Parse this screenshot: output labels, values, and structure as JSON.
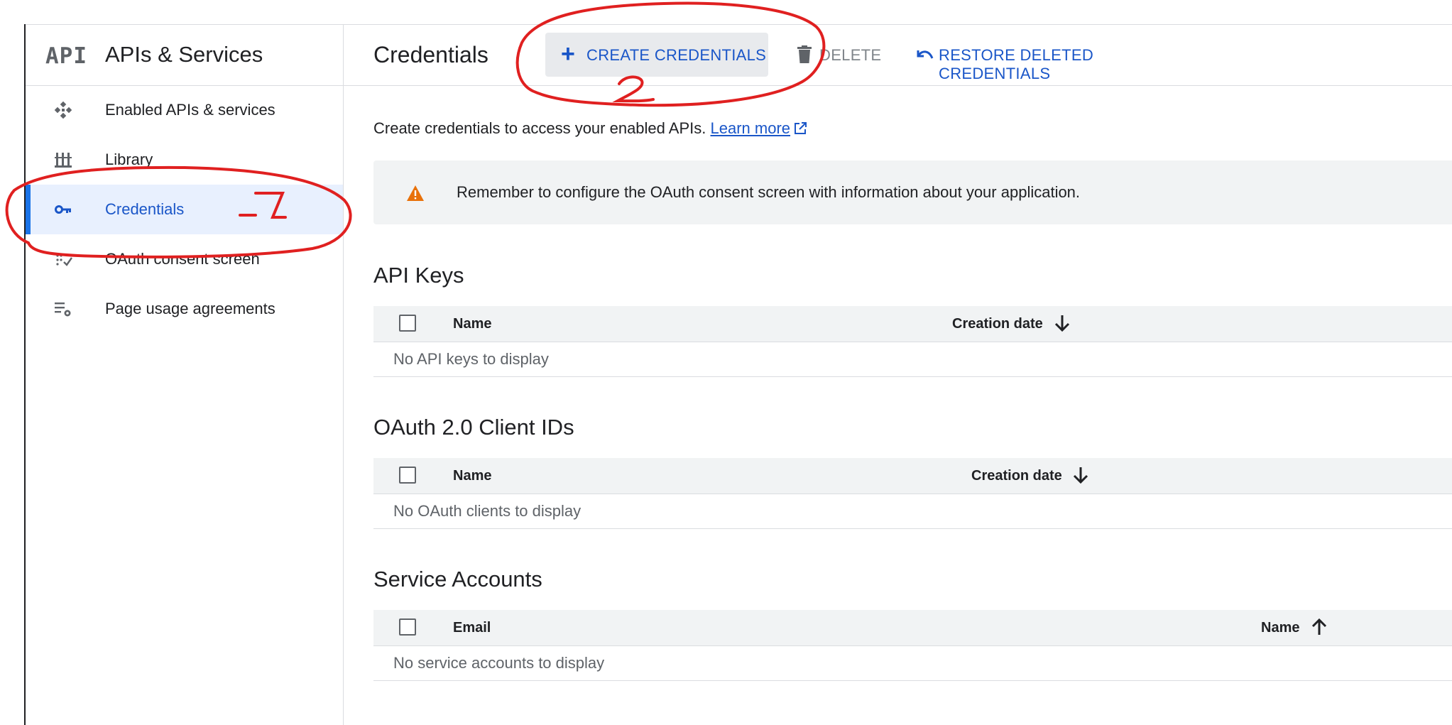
{
  "brand": {
    "logo": "API",
    "title": "APIs & Services"
  },
  "sidebar": {
    "items": [
      {
        "label": "Enabled APIs & services",
        "icon": "enabled-apis-icon",
        "active": false
      },
      {
        "label": "Library",
        "icon": "library-icon",
        "active": false
      },
      {
        "label": "Credentials",
        "icon": "key-icon",
        "active": true
      },
      {
        "label": "OAuth consent screen",
        "icon": "oauth-consent-icon",
        "active": false
      },
      {
        "label": "Page usage agreements",
        "icon": "settings-list-icon",
        "active": false
      }
    ]
  },
  "header": {
    "title": "Credentials",
    "create_label": "CREATE CREDENTIALS",
    "delete_label": "DELETE",
    "restore_label": "RESTORE DELETED CREDENTIALS"
  },
  "main": {
    "intro_text": "Create credentials to access your enabled APIs.",
    "learn_more": "Learn more",
    "alert_text": "Remember to configure the OAuth consent screen with information about your application.",
    "api_keys": {
      "title": "API Keys",
      "columns": [
        "Name",
        "Creation date"
      ],
      "sort_column": "Creation date",
      "sort_direction": "descending",
      "empty": "No API keys to display"
    },
    "oauth_clients": {
      "title": "OAuth 2.0 Client IDs",
      "columns": [
        "Name",
        "Creation date"
      ],
      "sort_column": "Creation date",
      "sort_direction": "descending",
      "empty": "No OAuth clients to display"
    },
    "service_accounts": {
      "title": "Service Accounts",
      "columns": [
        "Email",
        "Name"
      ],
      "sort_column": "Name",
      "sort_direction": "ascending",
      "empty": "No service accounts to display"
    }
  },
  "annotations": {
    "step1": "1",
    "step2": "2",
    "color": "#e02020"
  },
  "colors": {
    "accent": "#1a56c8",
    "active_bg": "#e8f0fe",
    "warning": "#e8710a"
  }
}
